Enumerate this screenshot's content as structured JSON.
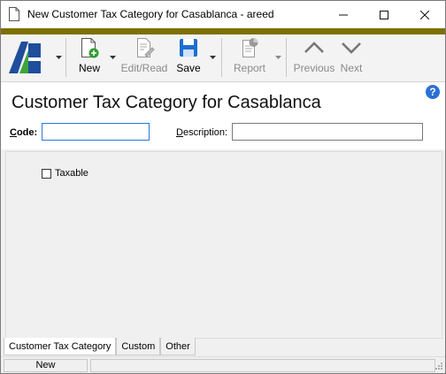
{
  "window": {
    "title": "New Customer Tax Category for Casablanca - areed"
  },
  "toolbar": {
    "new_label": "New",
    "edit_label": "Edit/Read",
    "save_label": "Save",
    "report_label": "Report",
    "previous_label": "Previous",
    "next_label": "Next"
  },
  "header": {
    "title": "Customer Tax Category for Casablanca",
    "help_icon": "question-circle-icon"
  },
  "form": {
    "code_label_key": "C",
    "code_label_rest": "ode:",
    "code_value": "",
    "description_label_key": "D",
    "description_label_rest": "escription:",
    "description_value": ""
  },
  "content": {
    "taxable_label": "Taxable",
    "taxable_checked": false
  },
  "tabs": [
    {
      "label": "Customer Tax Category",
      "active": true
    },
    {
      "label": "Custom",
      "active": false
    },
    {
      "label": "Other",
      "active": false
    }
  ],
  "status": {
    "mode": "New"
  },
  "colors": {
    "accent_bar": "#7d7100",
    "logo_blue": "#1f4e9c",
    "logo_green": "#3ea53a",
    "save_blue": "#1e6fd0"
  }
}
